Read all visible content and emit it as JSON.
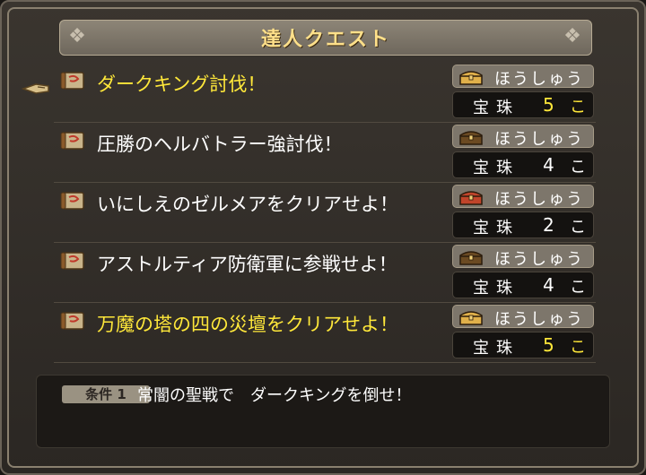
{
  "title": "達人クエスト",
  "quests": [
    {
      "name": "ダークキング討伐！",
      "highlighted": true,
      "chest": "gold",
      "reward_label": "ほうしゅう",
      "item": "宝珠",
      "count": "5",
      "unit": "こ",
      "count_highlighted": true
    },
    {
      "name": "圧勝のヘルバトラー強討伐！",
      "highlighted": false,
      "chest": "brown",
      "reward_label": "ほうしゅう",
      "item": "宝珠",
      "count": "4",
      "unit": "こ",
      "count_highlighted": false
    },
    {
      "name": "いにしえのゼルメアをクリアせよ！",
      "highlighted": false,
      "chest": "red",
      "reward_label": "ほうしゅう",
      "item": "宝珠",
      "count": "2",
      "unit": "こ",
      "count_highlighted": false
    },
    {
      "name": "アストルティア防衛軍に参戦せよ！",
      "highlighted": false,
      "chest": "brown",
      "reward_label": "ほうしゅう",
      "item": "宝珠",
      "count": "4",
      "unit": "こ",
      "count_highlighted": false
    },
    {
      "name": "万魔の塔の四の災壇をクリアせよ！",
      "highlighted": true,
      "chest": "gold",
      "reward_label": "ほうしゅう",
      "item": "宝珠",
      "count": "5",
      "unit": "こ",
      "count_highlighted": true
    }
  ],
  "condition": {
    "badge": "条件 1",
    "text": "常闇の聖戦で　ダークキングを倒せ！"
  },
  "colors": {
    "highlight": "#ffe83a",
    "chest_gold": "#e0b04a",
    "chest_brown": "#6b4a22",
    "chest_red": "#c0442a"
  }
}
